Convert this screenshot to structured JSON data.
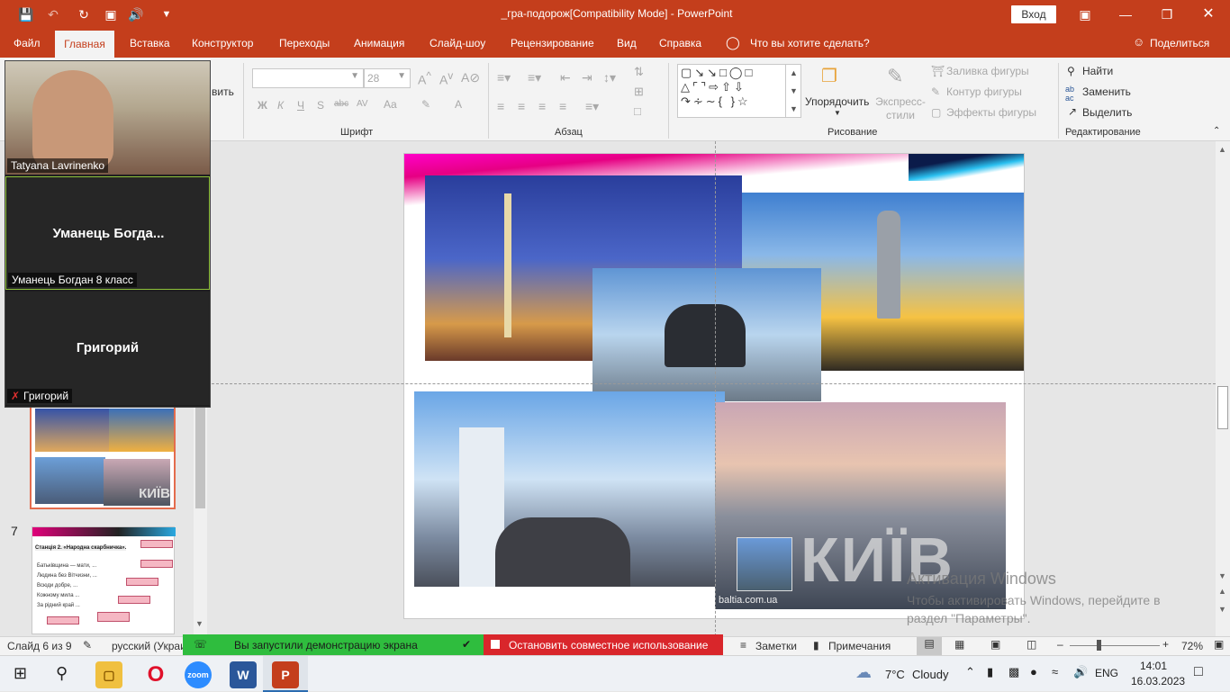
{
  "titlebar": {
    "doc_title": "_гра-подорож[Compatibility Mode]  -  PowerPoint",
    "signin_label": "Вход",
    "save_icon": "save-icon",
    "undo_icon": "undo-icon",
    "redo_icon": "redo-icon",
    "present_icon": "present-icon",
    "audio_icon": "audio-icon",
    "customize_icon": "customize-icon"
  },
  "menu": {
    "tabs": [
      "Файл",
      "Главная",
      "Вставка",
      "Конструктор",
      "Переходы",
      "Анимация",
      "Слайд-шоу",
      "Рецензирование",
      "Вид",
      "Справка"
    ],
    "search_placeholder": "Что вы хотите сделать?",
    "share_label": "Поделиться"
  },
  "ribbon": {
    "paste_fragment": "вить",
    "font_name": "",
    "font_size": "28",
    "groups": {
      "font": "Шрифт",
      "paragraph": "Абзац",
      "drawing": "Рисование",
      "editing": "Редактирование"
    },
    "font_buttons": [
      "Ж",
      "К",
      "Ч",
      "S",
      "abc",
      "AV",
      "Aa",
      "A"
    ],
    "arrange_label": "Упорядочить",
    "quick_styles_label": "Экспресс-стили",
    "shape_fill": "Заливка фигуры",
    "shape_outline": "Контур фигуры",
    "shape_effects": "Эффекты фигуры",
    "find": "Найти",
    "replace": "Заменить",
    "select": "Выделить"
  },
  "zoom_overlay": {
    "participants": [
      {
        "name": "Tatyana Lavrinenko",
        "center_text": ""
      },
      {
        "name": "Уманець Богдан 8 класс",
        "center_text": "Уманець  Богда..."
      },
      {
        "name": "Григорий",
        "center_text": "Григорий"
      }
    ]
  },
  "slide_panel": {
    "slide_number_7": "7",
    "thumb6_caption": "КИЇВ",
    "thumb7_title": "Станція 2. «Народна скарбничка».",
    "thumb7_lines": [
      "Батьківщина — мати, ...",
      "Людина без Вітчизни, ...",
      "Всюди добре, ...",
      "Кожному мила ...",
      "За рідний край ..."
    ]
  },
  "slide": {
    "caption": "КИЇВ",
    "source": "baltia.com.ua"
  },
  "watermark": {
    "title": "Активация Windows",
    "subtitle": "Чтобы активировать Windows, перейдите в раздел \"Параметры\"."
  },
  "statusbar": {
    "slide_info": "Слайд 6 из 9",
    "language": "русский (Украи",
    "sharing_notice": "Вы запустили демонстрацию экрана",
    "stop_sharing": "Остановить совместное использование",
    "notes": "Заметки",
    "comments": "Примечания",
    "zoom": "72%"
  },
  "taskbar": {
    "weather_temp": "7°C",
    "weather_text": "Cloudy",
    "lang": "ENG",
    "time": "14:01",
    "date": "16.03.2023",
    "apps": [
      "file-explorer-icon",
      "opera-icon",
      "zoom-icon",
      "word-icon",
      "powerpoint-icon"
    ]
  }
}
